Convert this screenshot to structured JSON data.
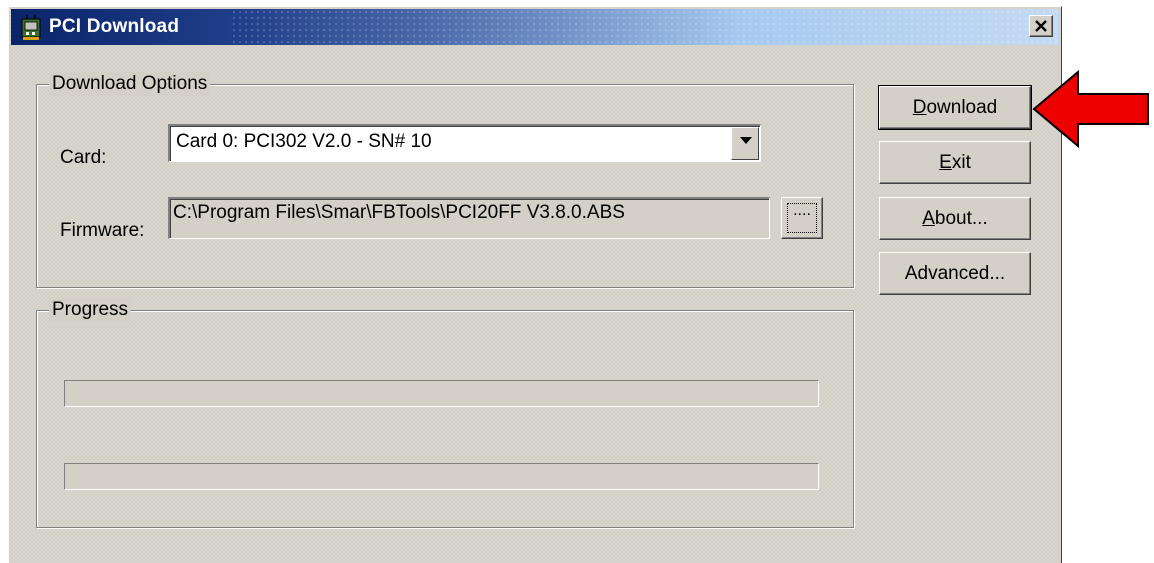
{
  "window": {
    "title": "PCI Download"
  },
  "download_options": {
    "group_label": "Download Options",
    "card_label": "Card:",
    "card_value": "Card 0:  PCI302 V2.0  -  SN# 10",
    "firmware_label": "Firmware:",
    "firmware_value": "C:\\Program Files\\Smar\\FBTools\\PCI20FF V3.8.0.ABS",
    "browse_label": "...."
  },
  "progress": {
    "group_label": "Progress",
    "bars": [
      {
        "value": 0
      },
      {
        "value": 0
      }
    ]
  },
  "buttons": {
    "download": {
      "mnemonic": "D",
      "rest": "ownload"
    },
    "exit": {
      "mnemonic": "E",
      "rest": "xit"
    },
    "about": {
      "mnemonic": "A",
      "rest": "bout..."
    },
    "advanced": {
      "label": "Advanced..."
    }
  },
  "icons": {
    "app": "pci-card-icon",
    "close": "close-icon",
    "dropdown": "chevron-down-icon",
    "annotation": "red-arrow-icon"
  },
  "colors": {
    "face": "#d4d0c8",
    "titlebar_start": "#0a246a",
    "titlebar_end": "#a6caf0",
    "annotation_arrow": "#ee0000"
  }
}
